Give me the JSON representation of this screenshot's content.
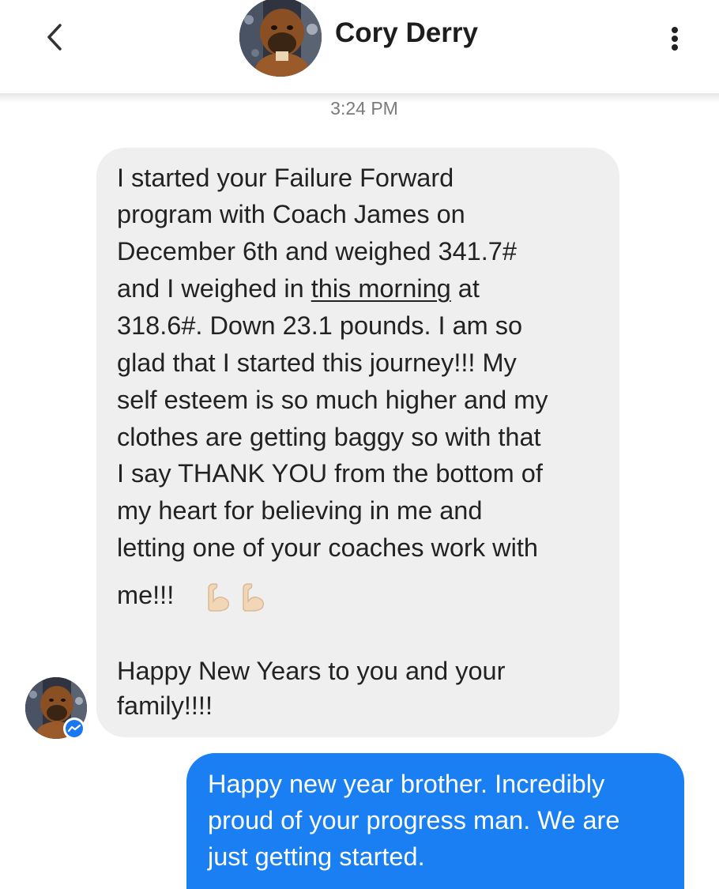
{
  "header": {
    "contact_name": "Cory Derry",
    "back_icon": "chevron-left-icon",
    "more_icon": "vertical-ellipsis-icon"
  },
  "conversation": {
    "timestamp": "3:24 PM",
    "incoming": {
      "lines": [
        "I started your Failure Forward",
        "program with Coach James on",
        "December 6th and weighed 341.7#",
        "and I weighed in ",
        "this morning",
        " at",
        "318.6#.   Down 23.1 pounds. I am so",
        "glad that I started this journey!!! My",
        "self esteem is so much higher and my",
        "clothes are getting baggy so with that",
        "I say THANK YOU from the bottom of",
        "my heart for believing in me and",
        "letting one of your coaches work with",
        "me!!!",
        "Happy New Years to you and your",
        "family!!!!"
      ],
      "emoji_icons": [
        "flexed-biceps-icon",
        "flexed-biceps-icon"
      ]
    },
    "outgoing": {
      "lines": [
        "Happy new year brother. Incredibly",
        "proud of your progress man. We are",
        "just getting started."
      ]
    }
  },
  "colors": {
    "incoming_bubble": "#efefef",
    "outgoing_bubble": "#1a7ff2",
    "messenger_badge": "#1877f2"
  }
}
